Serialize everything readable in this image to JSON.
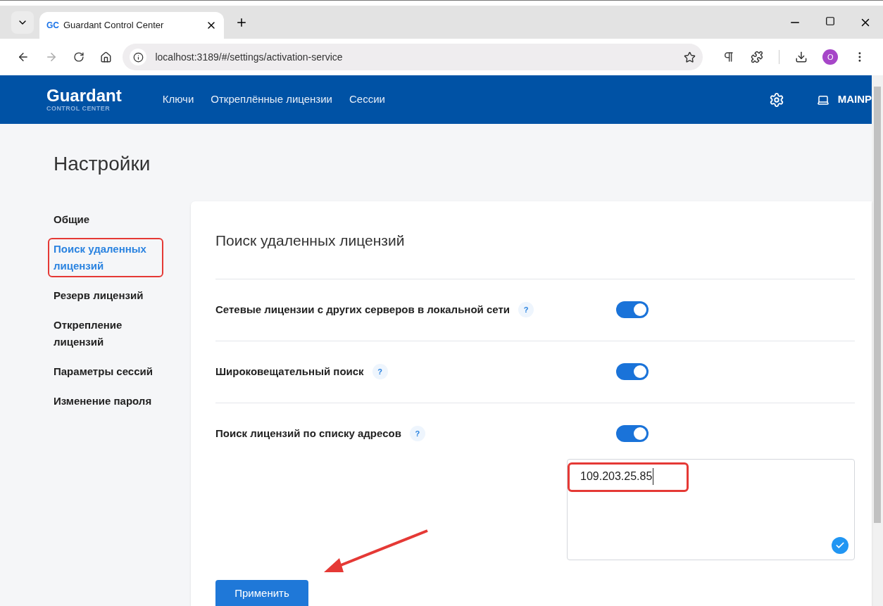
{
  "browser": {
    "tab_title": "Guardant Control Center",
    "tab_logo": "GC",
    "url": "localhost:3189/#/settings/activation-service",
    "profile_initial": "O"
  },
  "header": {
    "brand": "Guardant",
    "brand_sub": "CONTROL CENTER",
    "nav": [
      {
        "label": "Ключи"
      },
      {
        "label": "Откреплённые лицензии"
      },
      {
        "label": "Сессии"
      }
    ],
    "computer": "MAINP"
  },
  "page_title": "Настройки",
  "sidebar": {
    "items": [
      {
        "label": "Общие",
        "selected": false,
        "highlighted": false
      },
      {
        "label": "Поиск удаленных лицензий",
        "selected": true,
        "highlighted": true
      },
      {
        "label": "Резерв лицензий",
        "selected": false,
        "highlighted": false
      },
      {
        "label": "Открепление лицензий",
        "selected": false,
        "highlighted": false
      },
      {
        "label": "Параметры сессий",
        "selected": false,
        "highlighted": false
      },
      {
        "label": "Изменение пароля",
        "selected": false,
        "highlighted": false
      }
    ]
  },
  "panel": {
    "title": "Поиск удаленных лицензий",
    "settings": [
      {
        "label": "Сетевые лицензии с других серверов в локальной сети",
        "help": "?",
        "on": true
      },
      {
        "label": "Широковещательный поиск",
        "help": "?",
        "on": true
      },
      {
        "label": "Поиск лицензий по списку адресов",
        "help": "?",
        "on": true
      }
    ],
    "addresses": {
      "value": "109.203.25.85",
      "highlighted": true
    },
    "apply_button": "Применить"
  }
}
